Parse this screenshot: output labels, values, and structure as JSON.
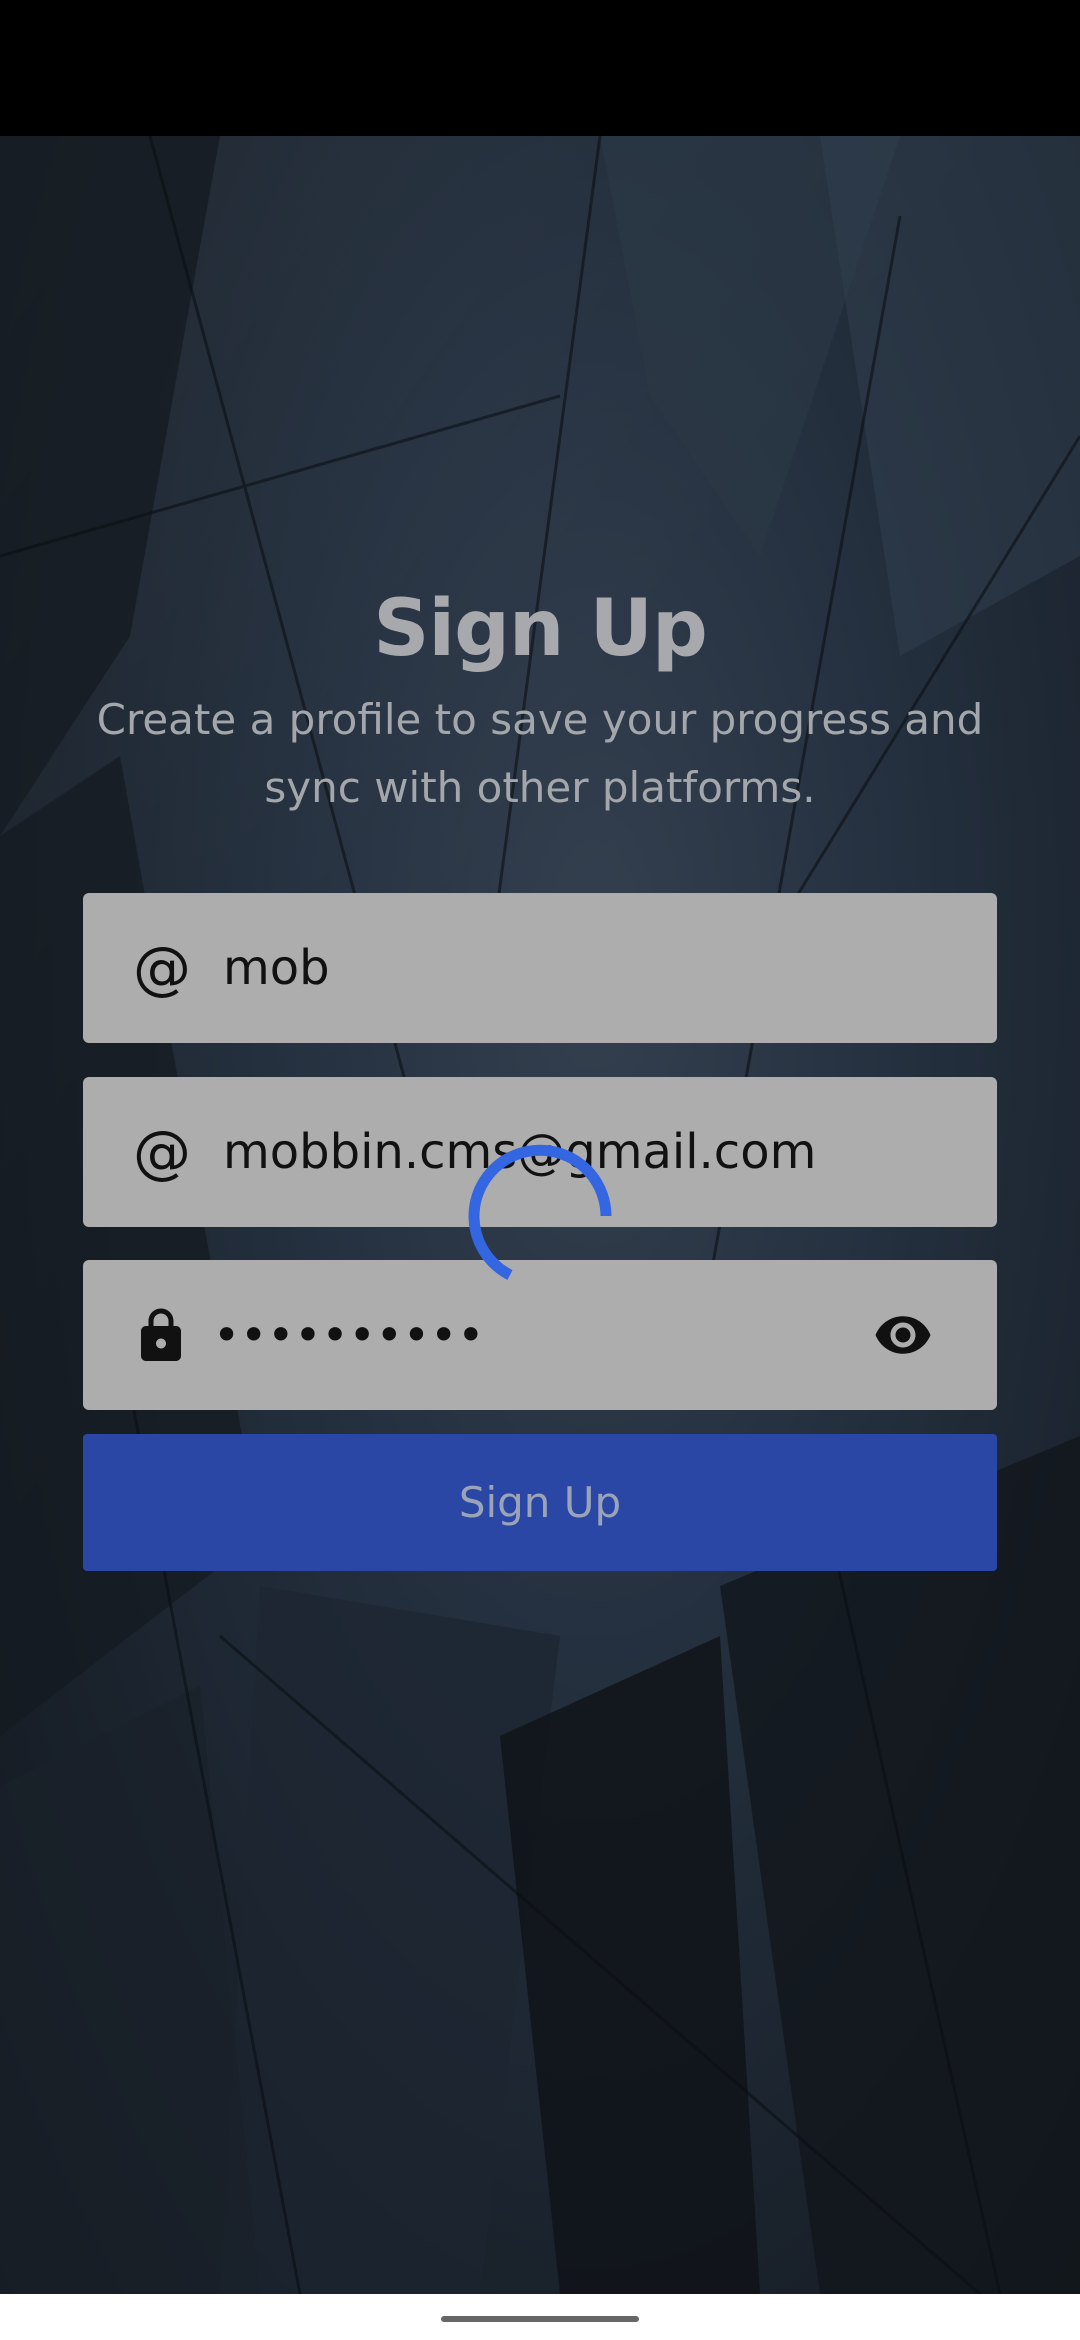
{
  "title": "Sign Up",
  "subtitle": "Create a profile to save your progress and sync with other platforms.",
  "fields": {
    "username": {
      "icon": "at-icon",
      "glyph": "@",
      "value": "mob"
    },
    "email": {
      "icon": "at-icon",
      "glyph": "@",
      "value": "mobbin.cms@gmail.com"
    },
    "password": {
      "icon": "lock-icon",
      "value": "••••••••••",
      "toggle_icon": "eye-icon"
    }
  },
  "signup_button": "Sign Up",
  "loading": true,
  "colors": {
    "accent": "#2a47a6",
    "spinner": "#3366e0",
    "field_bg": "#adadad"
  }
}
